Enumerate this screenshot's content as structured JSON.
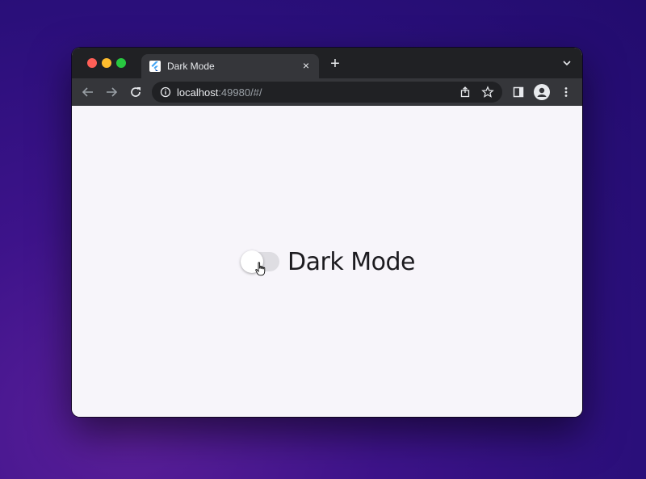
{
  "browser": {
    "tab": {
      "title": "Dark Mode",
      "close_label": "×"
    },
    "new_tab_label": "+",
    "address": {
      "host": "localhost",
      "rest": ":49980/#/"
    }
  },
  "page": {
    "toggle": {
      "label": "Dark Mode",
      "checked": false
    }
  },
  "colors": {
    "accent_close": "#ff5f57",
    "accent_minimize": "#febc2e",
    "accent_maximize": "#28c840",
    "page_background": "#f7f5fa"
  },
  "icons": [
    "back-icon",
    "forward-icon",
    "reload-icon",
    "info-icon",
    "share-icon",
    "star-icon",
    "side-panel-icon",
    "profile-icon",
    "more-menu-icon",
    "flutter-icon",
    "chevron-down-icon",
    "hand-cursor-icon"
  ]
}
